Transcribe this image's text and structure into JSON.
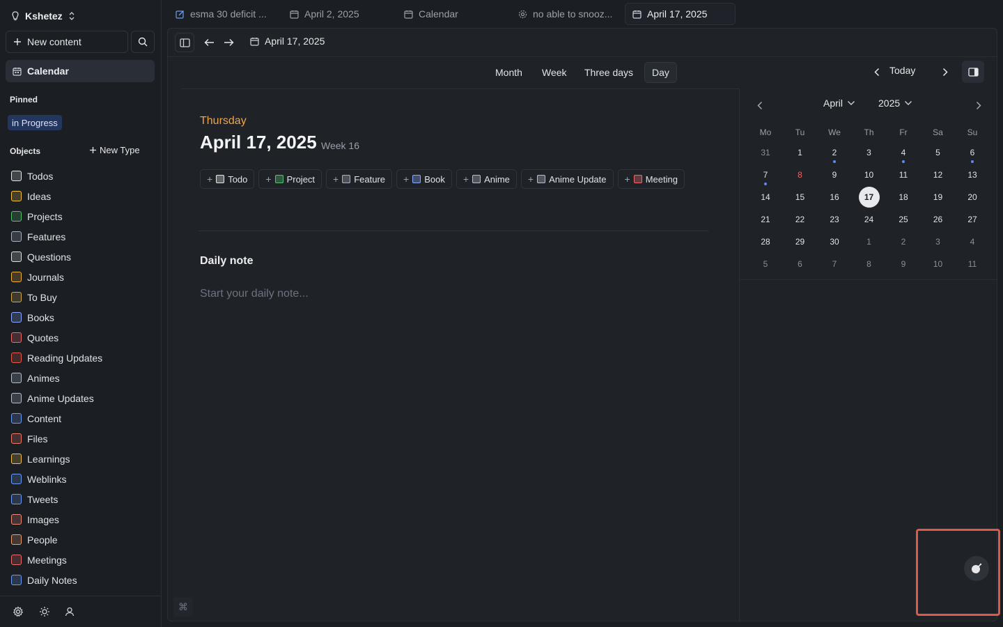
{
  "workspace": {
    "name": "Kshetez"
  },
  "sidebar": {
    "new_content_label": "New content",
    "calendar_label": "Calendar",
    "pinned_title": "Pinned",
    "pinned_items": [
      "in Progress"
    ],
    "objects_title": "Objects",
    "new_type_label": "New Type",
    "objects": [
      {
        "label": "Todos",
        "icon": "todo-icon",
        "color": "#e8e8e8"
      },
      {
        "label": "Ideas",
        "icon": "lightbulb-icon",
        "color": "#f5c542"
      },
      {
        "label": "Projects",
        "icon": "cube-icon",
        "color": "#56c271"
      },
      {
        "label": "Features",
        "icon": "gear-icon",
        "color": "#aab2c0"
      },
      {
        "label": "Questions",
        "icon": "question-icon",
        "color": "#e0e0e0"
      },
      {
        "label": "Journals",
        "icon": "pen-icon",
        "color": "#f0b13a"
      },
      {
        "label": "To Buy",
        "icon": "money-bag-icon",
        "color": "#d6a84a"
      },
      {
        "label": "Books",
        "icon": "book-icon",
        "color": "#8aa9ff"
      },
      {
        "label": "Quotes",
        "icon": "quote-icon",
        "color": "#ef6b6b"
      },
      {
        "label": "Reading Updates",
        "icon": "pin-icon",
        "color": "#e55a4d"
      },
      {
        "label": "Animes",
        "icon": "tv-icon",
        "color": "#b8bfcc"
      },
      {
        "label": "Anime Updates",
        "icon": "tv-icon",
        "color": "#b8bfcc"
      },
      {
        "label": "Content",
        "icon": "edit-icon",
        "color": "#6d9cf7"
      },
      {
        "label": "Files",
        "icon": "file-icon",
        "color": "#f07a6a"
      },
      {
        "label": "Learnings",
        "icon": "pencil-icon",
        "color": "#f2c14e"
      },
      {
        "label": "Weblinks",
        "icon": "globe-icon",
        "color": "#6d9cf7"
      },
      {
        "label": "Tweets",
        "icon": "bird-icon",
        "color": "#6d9cf7"
      },
      {
        "label": "Images",
        "icon": "image-icon",
        "color": "#f08a7a"
      },
      {
        "label": "People",
        "icon": "person-icon",
        "color": "#f0a070"
      },
      {
        "label": "Meetings",
        "icon": "meeting-icon",
        "color": "#ef6b6b"
      },
      {
        "label": "Daily Notes",
        "icon": "calendar-icon",
        "color": "#6d9cf7"
      }
    ]
  },
  "tabs": [
    {
      "label": "esma 30 deficit ...",
      "icon": "edit-icon",
      "active": false
    },
    {
      "label": "April 2, 2025",
      "icon": "calendar-icon",
      "active": false
    },
    {
      "label": "Calendar",
      "icon": "calendar-icon",
      "active": false
    },
    {
      "label": "no able to snooz...",
      "icon": "gear-icon",
      "active": false
    },
    {
      "label": "April 17, 2025",
      "icon": "calendar-icon",
      "active": true
    }
  ],
  "toolbar": {
    "doc_title": "April 17, 2025"
  },
  "views": {
    "items": [
      "Month",
      "Week",
      "Three days",
      "Day"
    ],
    "active": "Day",
    "today_label": "Today"
  },
  "day": {
    "weekday": "Thursday",
    "date": "April 17, 2025",
    "week": "Week 16",
    "add_buttons": [
      {
        "label": "Todo",
        "color": "#e8e8e8"
      },
      {
        "label": "Project",
        "color": "#56c271"
      },
      {
        "label": "Feature",
        "color": "#aab2c0"
      },
      {
        "label": "Book",
        "color": "#8aa9ff"
      },
      {
        "label": "Anime",
        "color": "#b8bfcc"
      },
      {
        "label": "Anime Update",
        "color": "#b8bfcc"
      },
      {
        "label": "Meeting",
        "color": "#ef6b6b"
      }
    ],
    "daily_note_title": "Daily note",
    "daily_note_placeholder": "Start your daily note..."
  },
  "mini_calendar": {
    "month": "April",
    "year": "2025",
    "weekdays": [
      "Mo",
      "Tu",
      "We",
      "Th",
      "Fr",
      "Sa",
      "Su"
    ],
    "weeks": [
      [
        "31",
        "1",
        "2",
        "3",
        "4",
        "5",
        "6"
      ],
      [
        "7",
        "8",
        "9",
        "10",
        "11",
        "12",
        "13"
      ],
      [
        "14",
        "15",
        "16",
        "17",
        "18",
        "19",
        "20"
      ],
      [
        "21",
        "22",
        "23",
        "24",
        "25",
        "26",
        "27"
      ],
      [
        "28",
        "29",
        "30",
        "1",
        "2",
        "3",
        "4"
      ],
      [
        "5",
        "6",
        "7",
        "8",
        "9",
        "10",
        "11"
      ]
    ],
    "selected": "17",
    "highlight_red": "8",
    "days_with_events": [
      "2",
      "4",
      "6",
      "7"
    ]
  },
  "shortcut_hint": "⌘",
  "colors": {
    "accent_orange": "#f0a44a",
    "event_dot": "#5b8cf5",
    "highlight_box": "#e1574a"
  }
}
